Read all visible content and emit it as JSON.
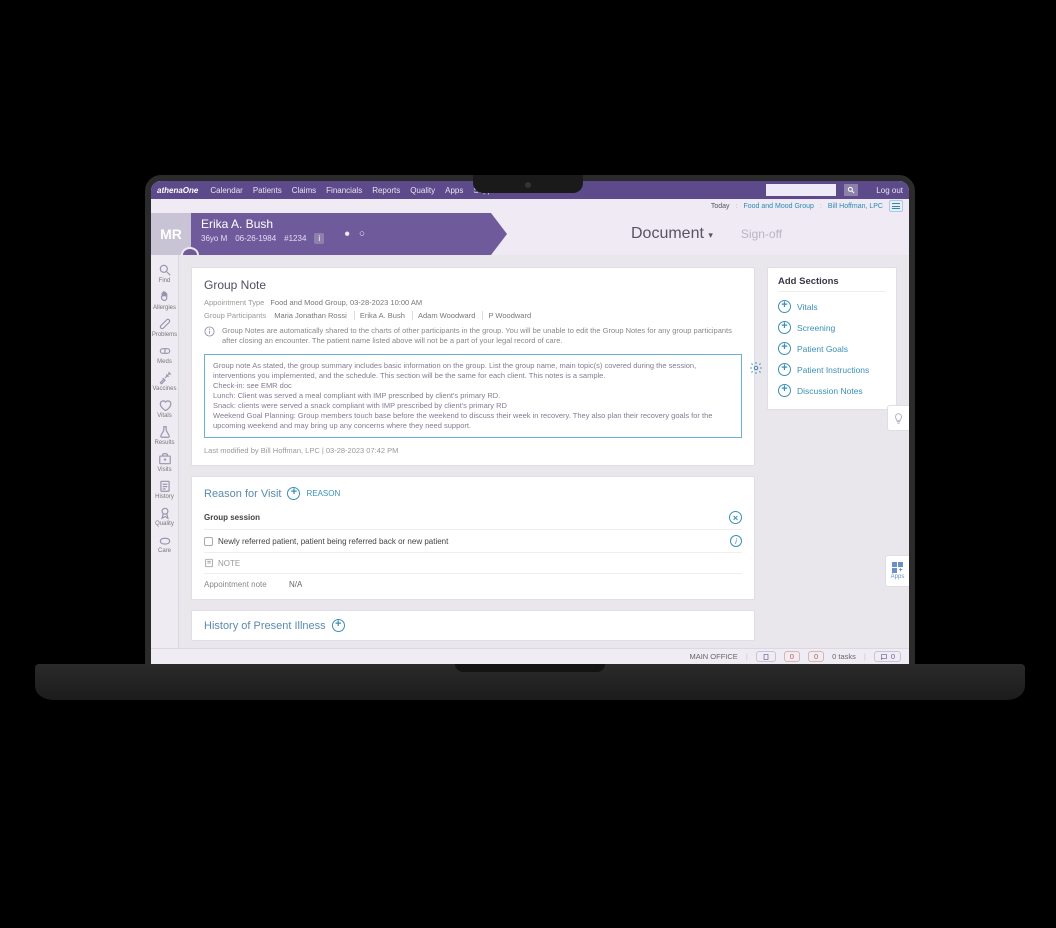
{
  "brand": "athenaOne",
  "nav": [
    "Calendar",
    "Patients",
    "Claims",
    "Financials",
    "Reports",
    "Quality",
    "Apps",
    "Support"
  ],
  "logout": "Log out",
  "context": {
    "today": "Today",
    "group": "Food and Mood Group",
    "user": "Bill Hoffman, LPC"
  },
  "patient": {
    "initials": "MR",
    "name": "Erika A. Bush",
    "age_sex": "36yo M",
    "dob": "06-26-1984",
    "id": "#1234"
  },
  "page": {
    "heading": "Document",
    "step_other": "Sign-off"
  },
  "group_note": {
    "title": "Group Note",
    "appt_type_label": "Appointment Type",
    "appt_type_value": "Food and Mood Group, 03-28-2023 10:00 AM",
    "participants_label": "Group Participants",
    "participants": [
      "Maria Jonathan Rossi",
      "Erika A. Bush",
      "Adam Woodward",
      "P Woodward"
    ],
    "info": "Group Notes are automatically shared to the charts of other participants in the group. You will be unable to edit the Group Notes for any group participants after closing an encounter. The patient name listed above will not be a part of your legal record of care.",
    "note_lines": [
      "Group note As stated, the group summary includes basic information on the group. List the group name, main topic(s) covered during the session, interventions you implemented, and the schedule. This section will be the same for each client. This notes is a sample.",
      "Check-in: see EMR doc",
      "Lunch: Client was served a meal compliant with IMP prescribed by client's primary RD.",
      "Snack: clients were served a snack compliant with IMP prescribed by client's primary RD",
      "Weekend Goal Planning: Group members touch base before the weekend to discuss their week in recovery. They also plan their recovery goals for the upcoming weekend and may bring up any concerns where they need support."
    ],
    "last_modified": "Last modified by Bill Hoffman, LPC | 03-28-2023 07:42 PM"
  },
  "reason_for_visit": {
    "title": "Reason for Visit",
    "link": "REASON",
    "group_session": "Group session",
    "referral_text": "Newly referred patient, patient being referred back or new patient",
    "note_label": "NOTE",
    "appt_note_label": "Appointment note",
    "appt_note_value": "N/A"
  },
  "hpi": {
    "title": "History of Present Illness"
  },
  "add_sections": {
    "title": "Add Sections",
    "items": [
      "Vitals",
      "Screening",
      "Patient Goals",
      "Patient Instructions",
      "Discussion Notes"
    ]
  },
  "sidebar": [
    {
      "id": "find",
      "label": "Find"
    },
    {
      "id": "allergies",
      "label": "Allergies"
    },
    {
      "id": "problems",
      "label": "Problems"
    },
    {
      "id": "meds",
      "label": "Meds"
    },
    {
      "id": "vaccines",
      "label": "Vaccines"
    },
    {
      "id": "vitals",
      "label": "Vitals"
    },
    {
      "id": "results",
      "label": "Results"
    },
    {
      "id": "visits",
      "label": "Visits"
    },
    {
      "id": "history",
      "label": "History"
    },
    {
      "id": "quality",
      "label": "Quality"
    },
    {
      "id": "care",
      "label": "Care"
    }
  ],
  "footer": {
    "office": "MAIN OFFICE",
    "count1": "0",
    "count2": "0",
    "tasks": "0 tasks",
    "msgs": "0"
  },
  "apps_fab_label": "Apps"
}
